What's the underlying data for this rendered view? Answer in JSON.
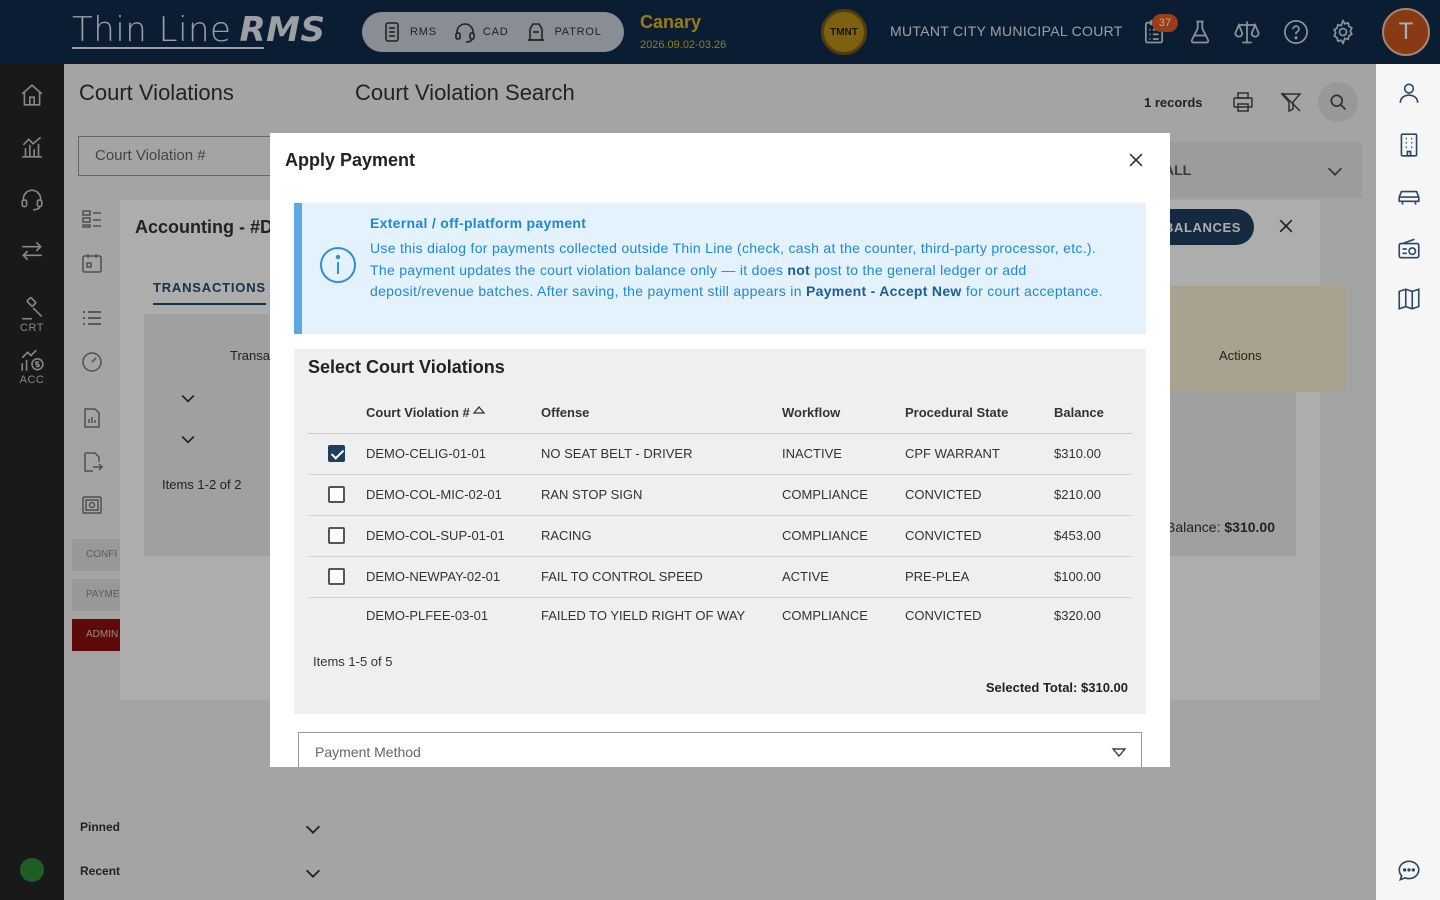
{
  "topbar": {
    "brand_main": "Thin Line",
    "brand_rms": "RMS",
    "modules": [
      {
        "label": "RMS",
        "icon": "server-icon"
      },
      {
        "label": "CAD",
        "icon": "headset-icon"
      },
      {
        "label": "PATROL",
        "icon": "patrol-icon"
      }
    ],
    "env_name": "Canary",
    "env_version": "2026.09.02-03.26",
    "seal_text": "TMNT",
    "court_name": "MUTANT CITY MUNICIPAL COURT",
    "notification_count": "37",
    "avatar_initial": "T"
  },
  "rail": {
    "items": [
      {
        "label": "",
        "icon": "home-icon"
      },
      {
        "label": "",
        "icon": "chart-icon"
      },
      {
        "label": "",
        "icon": "headset-icon"
      },
      {
        "label": "",
        "icon": "transfer-icon"
      },
      {
        "label": "CRT",
        "icon": "gavel-icon"
      },
      {
        "label": "ACC",
        "icon": "money-chart-icon"
      }
    ]
  },
  "page": {
    "nav_title": "Court Violations",
    "title": "Court Violation Search",
    "search_placeholder": "Court Violation #",
    "records": "1 records",
    "filter_value": "ALL",
    "side_buttons": [
      "CONFI",
      "PAYME",
      "ADMIN"
    ],
    "pinned": "Pinned",
    "recent": "Recent"
  },
  "accounting": {
    "title": "Accounting - #DI",
    "tab": "TRANSACTIONS",
    "balances_button": "BALANCES",
    "col_transaction": "Transa",
    "col_actions": "Actions",
    "items": "Items 1-2 of 2",
    "balance_label": "Balance:",
    "balance_value": "$310.00"
  },
  "dialog": {
    "title": "Apply Payment",
    "info_heading": "External / off-platform payment",
    "info_part1": "Use this dialog for payments collected outside Thin Line (check, cash at the counter, third-party processor, etc.). The payment updates the court violation balance only — it does ",
    "info_not": "not",
    "info_part2": " post to the general ledger or add deposit/revenue batches. After saving, the payment still appears in ",
    "info_link": "Payment - Accept New",
    "info_part3": " for court acceptance.",
    "select_title": "Select Court Violations",
    "columns": [
      "Court Violation #",
      "Offense",
      "Workflow",
      "Procedural State",
      "Balance"
    ],
    "rows": [
      {
        "checked": true,
        "number": "DEMO-CELIG-01-01",
        "offense": "NO SEAT BELT - DRIVER",
        "workflow": "INACTIVE",
        "state": "CPF WARRANT",
        "balance": "$310.00"
      },
      {
        "checked": false,
        "number": "DEMO-COL-MIC-02-01",
        "offense": "RAN STOP SIGN",
        "workflow": "COMPLIANCE",
        "state": "CONVICTED",
        "balance": "$210.00"
      },
      {
        "checked": false,
        "number": "DEMO-COL-SUP-01-01",
        "offense": "RACING",
        "workflow": "COMPLIANCE",
        "state": "CONVICTED",
        "balance": "$453.00"
      },
      {
        "checked": false,
        "number": "DEMO-NEWPAY-02-01",
        "offense": "FAIL TO CONTROL SPEED",
        "workflow": "ACTIVE",
        "state": "PRE-PLEA",
        "balance": "$100.00"
      },
      {
        "checked": null,
        "number": "DEMO-PLFEE-03-01",
        "offense": "FAILED TO YIELD RIGHT OF WAY",
        "workflow": "COMPLIANCE",
        "state": "CONVICTED",
        "balance": "$320.00"
      }
    ],
    "items_count": "Items 1-5 of 5",
    "selected_total_label": "Selected Total:",
    "selected_total_value": "$310.00",
    "payment_method_placeholder": "Payment Method"
  },
  "colors": {
    "topbar": "#0f2c4a",
    "env_accent": "#e0b526",
    "info_text": "#1e88d6",
    "primary": "#1f3f5f",
    "admin": "#8b0f0f"
  }
}
